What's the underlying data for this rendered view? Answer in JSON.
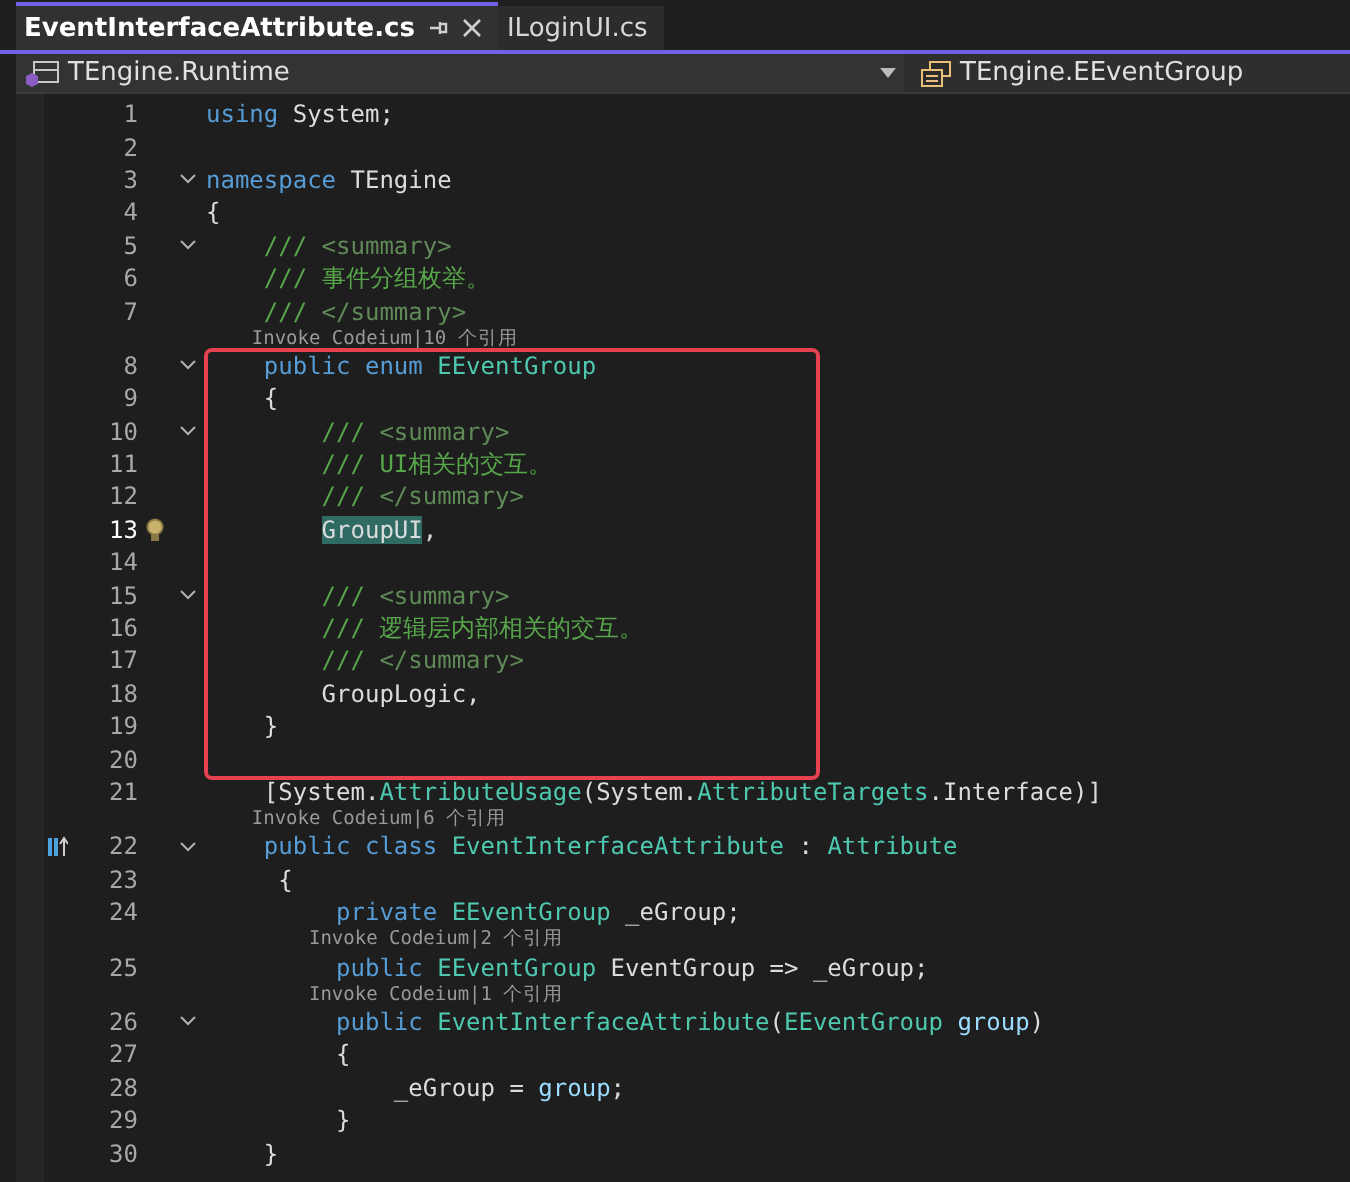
{
  "tabs": [
    {
      "label": "EventInterfaceAttribute.cs",
      "selected": true
    },
    {
      "label": "ILoginUI.cs",
      "selected": false
    }
  ],
  "navigation": {
    "project": "TEngine.Runtime",
    "member": "TEngine.EEventGroup"
  },
  "lines": [
    {
      "kind": "code",
      "number": "1",
      "current": false,
      "fold": false,
      "tokens": [
        {
          "text": "using",
          "kind": "keyword"
        },
        {
          "text": " System;",
          "kind": "plain"
        }
      ]
    },
    {
      "kind": "code",
      "number": "2",
      "current": false,
      "fold": false
    },
    {
      "kind": "code",
      "number": "3",
      "current": false,
      "fold": true,
      "tokens": [
        {
          "text": "namespace",
          "kind": "keyword"
        },
        {
          "text": " TEngine",
          "kind": "plain"
        }
      ]
    },
    {
      "kind": "code",
      "number": "4",
      "current": false,
      "fold": false,
      "tokens": [
        {
          "text": "{",
          "kind": "plain"
        }
      ]
    },
    {
      "kind": "code",
      "number": "5",
      "current": false,
      "fold": true,
      "tokens": [
        {
          "text": "    ///",
          "kind": "comment"
        },
        {
          "text": " <summary>",
          "kind": "doc-tag"
        }
      ]
    },
    {
      "kind": "code",
      "number": "6",
      "current": false,
      "fold": false,
      "tokens": [
        {
          "text": "    /// 事件分组枚举。",
          "kind": "comment"
        }
      ]
    },
    {
      "kind": "code",
      "number": "7",
      "current": false,
      "fold": false,
      "tokens": [
        {
          "text": "    ///",
          "kind": "comment"
        },
        {
          "text": " </summary>",
          "kind": "doc-tag"
        }
      ]
    },
    {
      "kind": "codelens",
      "text": "    Invoke Codeium|10 个引用"
    },
    {
      "kind": "highlight-frame",
      "lines": [
        {
          "kind": "code",
          "number": "8",
          "current": false,
          "fold": true,
          "tokens": [
            {
              "text": "    public",
              "kind": "keyword"
            },
            {
              "text": " enum",
              "kind": "keyword"
            },
            {
              "text": " EEventGroup",
              "kind": "type"
            }
          ]
        },
        {
          "kind": "code",
          "number": "9",
          "current": false,
          "fold": false,
          "tokens": [
            {
              "text": "    {",
              "kind": "plain"
            }
          ]
        },
        {
          "kind": "code",
          "number": "10",
          "current": false,
          "fold": true,
          "tokens": [
            {
              "text": "        ///",
              "kind": "comment"
            },
            {
              "text": " <summary>",
              "kind": "doc-tag"
            }
          ]
        },
        {
          "kind": "code",
          "number": "11",
          "current": false,
          "fold": false,
          "tokens": [
            {
              "text": "        /// UI相关的交互。",
              "kind": "comment"
            }
          ]
        },
        {
          "kind": "code",
          "number": "12",
          "current": false,
          "fold": false,
          "tokens": [
            {
              "text": "        ///",
              "kind": "comment"
            },
            {
              "text": " </summary>",
              "kind": "doc-tag"
            }
          ]
        },
        {
          "kind": "code",
          "number": "13",
          "current": true,
          "fold": false,
          "gutter_icon": {
            "kind": "lightbulb"
          },
          "tokens": [
            {
              "text": "        GroupUI",
              "kind": "match"
            },
            {
              "text": ",",
              "kind": "plain"
            }
          ]
        },
        {
          "kind": "code",
          "number": "14",
          "current": false,
          "fold": false
        },
        {
          "kind": "code",
          "number": "15",
          "current": false,
          "fold": true,
          "tokens": [
            {
              "text": "        ///",
              "kind": "comment"
            },
            {
              "text": " <summary>",
              "kind": "doc-tag"
            }
          ]
        },
        {
          "kind": "code",
          "number": "16",
          "current": false,
          "fold": false,
          "tokens": [
            {
              "text": "        /// 逻辑层内部相关的交互。",
              "kind": "comment"
            }
          ]
        },
        {
          "kind": "code",
          "number": "17",
          "current": false,
          "fold": false,
          "tokens": [
            {
              "text": "        ///",
              "kind": "comment"
            },
            {
              "text": " </summary>",
              "kind": "doc-tag"
            }
          ]
        },
        {
          "kind": "code",
          "number": "18",
          "current": false,
          "fold": false,
          "tokens": [
            {
              "text": "        GroupLogic,",
              "kind": "plain"
            }
          ]
        },
        {
          "kind": "code",
          "number": "19",
          "current": false,
          "fold": false,
          "tokens": [
            {
              "text": "    }",
              "kind": "plain"
            }
          ]
        },
        {
          "kind": "code",
          "number": "20",
          "current": false,
          "fold": false
        }
      ]
    },
    {
      "kind": "code",
      "number": "21",
      "current": false,
      "fold": false,
      "tokens": [
        {
          "text": "    [System.",
          "kind": "plain"
        },
        {
          "text": "AttributeUsage",
          "kind": "type"
        },
        {
          "text": "(System.",
          "kind": "plain"
        },
        {
          "text": "AttributeTargets",
          "kind": "type"
        },
        {
          "text": ".Interface)]",
          "kind": "plain"
        }
      ]
    },
    {
      "kind": "codelens",
      "text": "    Invoke Codeium|6 个引用"
    },
    {
      "kind": "code",
      "number": "22",
      "current": false,
      "fold": true,
      "gutter_icon": {
        "kind": "implementation"
      },
      "tokens": [
        {
          "text": "    public",
          "kind": "keyword"
        },
        {
          "text": " class",
          "kind": "keyword"
        },
        {
          "text": " EventInterfaceAttribute",
          "kind": "type"
        },
        {
          "text": " : ",
          "kind": "plain"
        },
        {
          "text": "Attribute",
          "kind": "type"
        }
      ]
    },
    {
      "kind": "code",
      "number": "23",
      "current": false,
      "fold": false,
      "tokens": [
        {
          "text": "     {",
          "kind": "plain"
        }
      ]
    },
    {
      "kind": "code",
      "number": "24",
      "current": false,
      "fold": false,
      "tokens": [
        {
          "text": "         private",
          "kind": "keyword"
        },
        {
          "text": " EEventGroup",
          "kind": "type"
        },
        {
          "text": " _eGroup;",
          "kind": "plain"
        }
      ]
    },
    {
      "kind": "codelens",
      "text": "         Invoke Codeium|2 个引用"
    },
    {
      "kind": "code",
      "number": "25",
      "current": false,
      "fold": false,
      "tokens": [
        {
          "text": "         public",
          "kind": "keyword"
        },
        {
          "text": " EEventGroup",
          "kind": "type"
        },
        {
          "text": " EventGroup => _eGroup;",
          "kind": "plain"
        }
      ]
    },
    {
      "kind": "codelens",
      "text": "         Invoke Codeium|1 个引用"
    },
    {
      "kind": "code",
      "number": "26",
      "current": false,
      "fold": true,
      "tokens": [
        {
          "text": "         public",
          "kind": "keyword"
        },
        {
          "text": " EventInterfaceAttribute",
          "kind": "type"
        },
        {
          "text": "(",
          "kind": "plain"
        },
        {
          "text": "EEventGroup",
          "kind": "type"
        },
        {
          "text": " group",
          "kind": "param"
        },
        {
          "text": ")",
          "kind": "plain"
        }
      ]
    },
    {
      "kind": "code",
      "number": "27",
      "current": false,
      "fold": false,
      "tokens": [
        {
          "text": "         {",
          "kind": "plain"
        }
      ]
    },
    {
      "kind": "code",
      "number": "28",
      "current": false,
      "fold": false,
      "tokens": [
        {
          "text": "             _eGroup = ",
          "kind": "plain"
        },
        {
          "text": "group",
          "kind": "param"
        },
        {
          "text": ";",
          "kind": "plain"
        }
      ]
    },
    {
      "kind": "code",
      "number": "29",
      "current": false,
      "fold": false,
      "tokens": [
        {
          "text": "         }",
          "kind": "plain"
        }
      ]
    },
    {
      "kind": "code",
      "number": "30",
      "current": false,
      "fold": false,
      "tokens": [
        {
          "text": "    }",
          "kind": "plain"
        }
      ]
    }
  ]
}
